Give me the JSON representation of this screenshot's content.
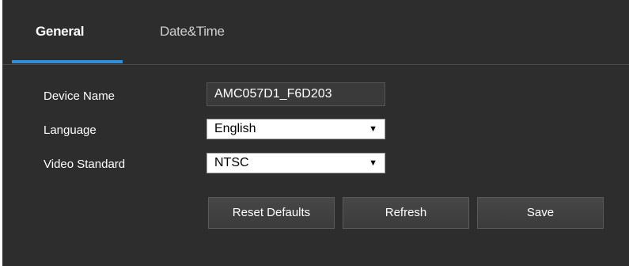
{
  "tabs": [
    {
      "label": "General",
      "active": true
    },
    {
      "label": "Date&Time",
      "active": false
    }
  ],
  "form": {
    "device_name": {
      "label": "Device Name",
      "value": "AMC057D1_F6D203"
    },
    "language": {
      "label": "Language",
      "selected": "English"
    },
    "video_standard": {
      "label": "Video Standard",
      "selected": "NTSC"
    }
  },
  "buttons": {
    "reset": "Reset Defaults",
    "refresh": "Refresh",
    "save": "Save"
  },
  "colors": {
    "background": "#2d2d2d",
    "accent": "#2f8fd8",
    "button": "#434343"
  },
  "icons": {
    "dropdown": "caret-down-icon"
  }
}
